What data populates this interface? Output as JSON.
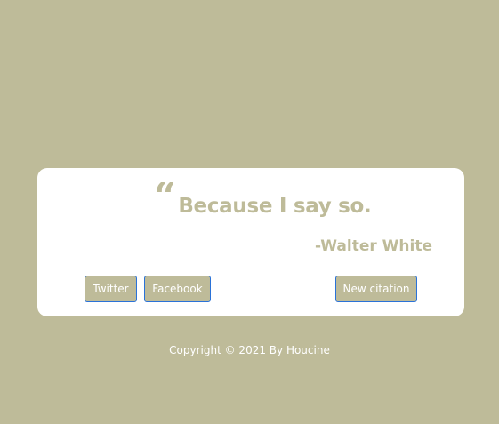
{
  "quote": {
    "icon": "quote-open-icon",
    "text": "Because I say so.",
    "author": "-Walter White"
  },
  "buttons": {
    "twitter_label": "Twitter",
    "facebook_label": "Facebook",
    "new_label": "New citation"
  },
  "footer": {
    "copyright": "Copyright © 2021 By Houcine"
  },
  "colors": {
    "background": "#bebb99",
    "card": "#ffffff",
    "accent": "#bebb99",
    "button_border": "#2a72d8"
  }
}
